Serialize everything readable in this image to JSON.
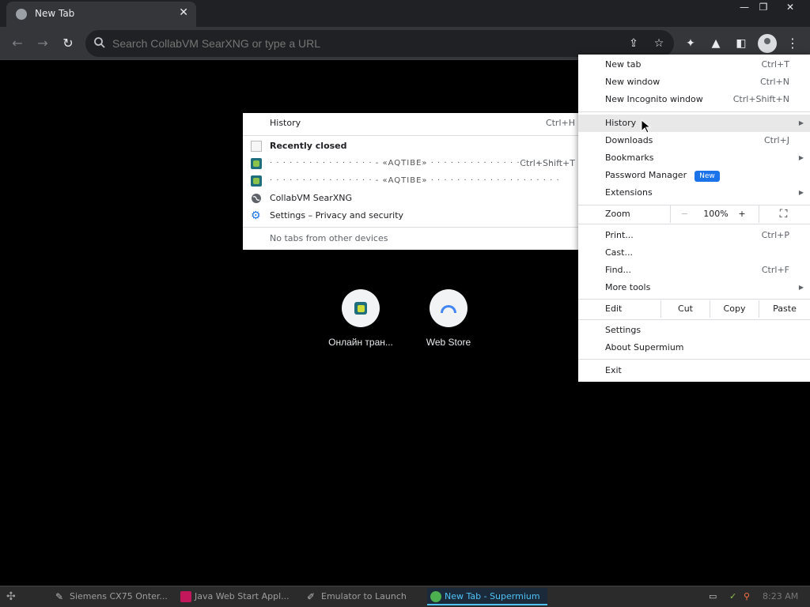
{
  "window": {
    "tab_title": "New Tab",
    "tab_close": "✕",
    "minimize": "—",
    "restore": "❐",
    "close": "✕"
  },
  "toolbar": {
    "back": "←",
    "forward": "→",
    "reload": "↻",
    "omnibox_placeholder": "Search CollabVM SearXNG or type a URL",
    "share": "⇪",
    "bookmark_star": "☆",
    "extensions": "✦",
    "labs": "▲",
    "sidepanel": "◧",
    "menu": "⋮"
  },
  "shortcuts": [
    {
      "label": "Онлайн тран..."
    },
    {
      "label": "Web Store"
    }
  ],
  "main_menu": {
    "items": {
      "new_tab": {
        "label": "New tab",
        "shortcut": "Ctrl+T"
      },
      "new_window": {
        "label": "New window",
        "shortcut": "Ctrl+N"
      },
      "new_incognito": {
        "label": "New Incognito window",
        "shortcut": "Ctrl+Shift+N"
      },
      "history": {
        "label": "History"
      },
      "downloads": {
        "label": "Downloads",
        "shortcut": "Ctrl+J"
      },
      "bookmarks": {
        "label": "Bookmarks"
      },
      "password_manager": {
        "label": "Password Manager",
        "badge": "New"
      },
      "extensions": {
        "label": "Extensions"
      },
      "zoom": {
        "label": "Zoom",
        "minus": "−",
        "value": "100%",
        "plus": "+",
        "fullscreen": "⛶"
      },
      "print": {
        "label": "Print...",
        "shortcut": "Ctrl+P"
      },
      "cast": {
        "label": "Cast..."
      },
      "find": {
        "label": "Find...",
        "shortcut": "Ctrl+F"
      },
      "more_tools": {
        "label": "More tools"
      },
      "edit": {
        "label": "Edit",
        "cut": "Cut",
        "copy": "Copy",
        "paste": "Paste"
      },
      "settings": {
        "label": "Settings"
      },
      "about": {
        "label": "About Supermium"
      },
      "exit": {
        "label": "Exit"
      }
    }
  },
  "history_menu": {
    "history": {
      "label": "History",
      "shortcut": "Ctrl+H"
    },
    "recently_closed": "Recently closed",
    "entries": [
      {
        "label": "· · · · · · · · · · · · · · · ·  - «AQTIBE»  · · · · · · · · · · · · · · · · · · · ·",
        "shortcut": "Ctrl+Shift+T"
      },
      {
        "label": "· · · · · · · · · · · · · · · ·  - «AQTIBE»  · · · · · · · · · · · · · · · · · · · ·",
        "shortcut": ""
      }
    ],
    "searxng": "CollabVM SearXNG",
    "settings_privacy": "Settings – Privacy and security",
    "no_tabs": "No tabs from other devices"
  },
  "taskbar": {
    "tasks": [
      {
        "label": "Siemens CX75 Onter..."
      },
      {
        "label": "Java Web Start Appl..."
      },
      {
        "label": "Emulator to Launch"
      },
      {
        "label": "New Tab - Supermium"
      }
    ],
    "clock": "8:23 AM"
  },
  "colors": {
    "accent": "#1a73e8",
    "toolbar": "#35363a",
    "titlebar": "#202124"
  }
}
